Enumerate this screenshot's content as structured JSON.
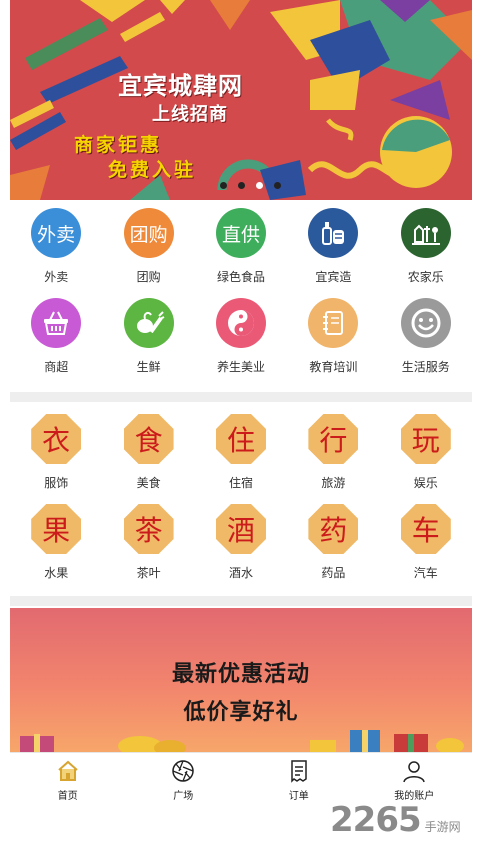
{
  "banner": {
    "title": "宜宾城肆网",
    "subtitle": "上线招商",
    "slogan_line1": "商家钜惠",
    "slogan_line2": "免费入驻",
    "dots_count": 4,
    "active_dot": 3,
    "colors": {
      "background": "#d24a4c",
      "accent": "#f5d400"
    }
  },
  "categories": [
    {
      "label": "外卖",
      "icon_text": "外卖",
      "color": "#3b8ed8"
    },
    {
      "label": "团购",
      "icon_text": "团购",
      "color": "#ee8a39"
    },
    {
      "label": "绿色食品",
      "icon_text": "直供",
      "color": "#3fae5c"
    },
    {
      "label": "宜宾造",
      "icon": "bottles-icon",
      "color": "#2b5a9c"
    },
    {
      "label": "农家乐",
      "icon": "farm-icon",
      "color": "#2c6430"
    },
    {
      "label": "商超",
      "icon": "basket-icon",
      "color": "#c95ad6"
    },
    {
      "label": "生鲜",
      "icon": "vegetables-icon",
      "color": "#5cb641"
    },
    {
      "label": "养生美业",
      "icon": "yinyang-icon",
      "color": "#ea5a77"
    },
    {
      "label": "教育培训",
      "icon": "notebook-icon",
      "color": "#f0b46a"
    },
    {
      "label": "生活服务",
      "icon": "smiley-icon",
      "color": "#9a9a9a"
    }
  ],
  "life_categories": [
    {
      "label": "服饰",
      "char": "衣"
    },
    {
      "label": "美食",
      "char": "食"
    },
    {
      "label": "住宿",
      "char": "住"
    },
    {
      "label": "旅游",
      "char": "行"
    },
    {
      "label": "娱乐",
      "char": "玩"
    },
    {
      "label": "水果",
      "char": "果"
    },
    {
      "label": "茶叶",
      "char": "茶"
    },
    {
      "label": "酒水",
      "char": "酒"
    },
    {
      "label": "药品",
      "char": "药"
    },
    {
      "label": "汽车",
      "char": "车"
    }
  ],
  "promo": {
    "line1": "最新优惠活动",
    "line2": "低价享好礼"
  },
  "tabbar": [
    {
      "label": "首页",
      "icon": "home-icon",
      "active": true
    },
    {
      "label": "广场",
      "icon": "aperture-icon"
    },
    {
      "label": "订单",
      "icon": "order-icon"
    },
    {
      "label": "我的账户",
      "icon": "user-icon"
    }
  ],
  "watermark": {
    "number": "2265",
    "text": "手游网"
  }
}
